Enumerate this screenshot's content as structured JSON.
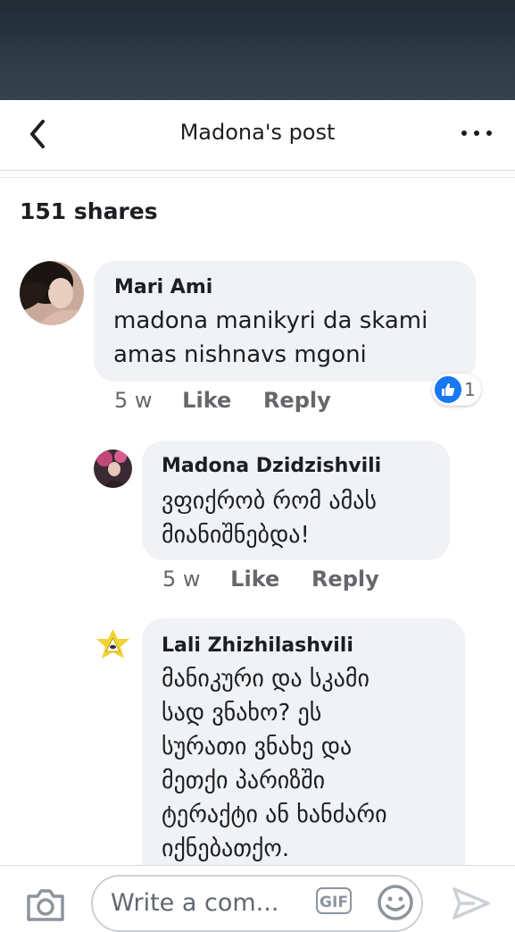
{
  "header": {
    "title": "Madona's post"
  },
  "shares": "151 shares",
  "comments": [
    {
      "author": "Mari Ami",
      "text_lines": [
        "madona manikyri da skami",
        "amas nishnavs mgoni"
      ],
      "time": "5 w",
      "like_label": "Like",
      "reply_label": "Reply",
      "reactions": {
        "count": "1",
        "type": "like-icon"
      }
    },
    {
      "author": "Madona Dzidzishvili",
      "text_lines": [
        "ვფიქრობ რომ ამას",
        "მიანიშნებდა!"
      ],
      "time": "5 w",
      "like_label": "Like",
      "reply_label": "Reply"
    },
    {
      "author": "Lali Zhizhilashvili",
      "text_lines": [
        "მანიკური და სკამი",
        "სად ვნახო? ეს",
        "სურათი ვნახე და",
        "მეთქი პარიზში",
        "ტერაქტი ან ხანძარი",
        "იქნებათქო."
      ]
    }
  ],
  "composer": {
    "placeholder": "Write a com...",
    "gif_label": "GIF"
  },
  "colors": {
    "like_blue": "#1877f2",
    "bubble_gray": "#f0f2f5",
    "meta_gray": "#65676b"
  }
}
